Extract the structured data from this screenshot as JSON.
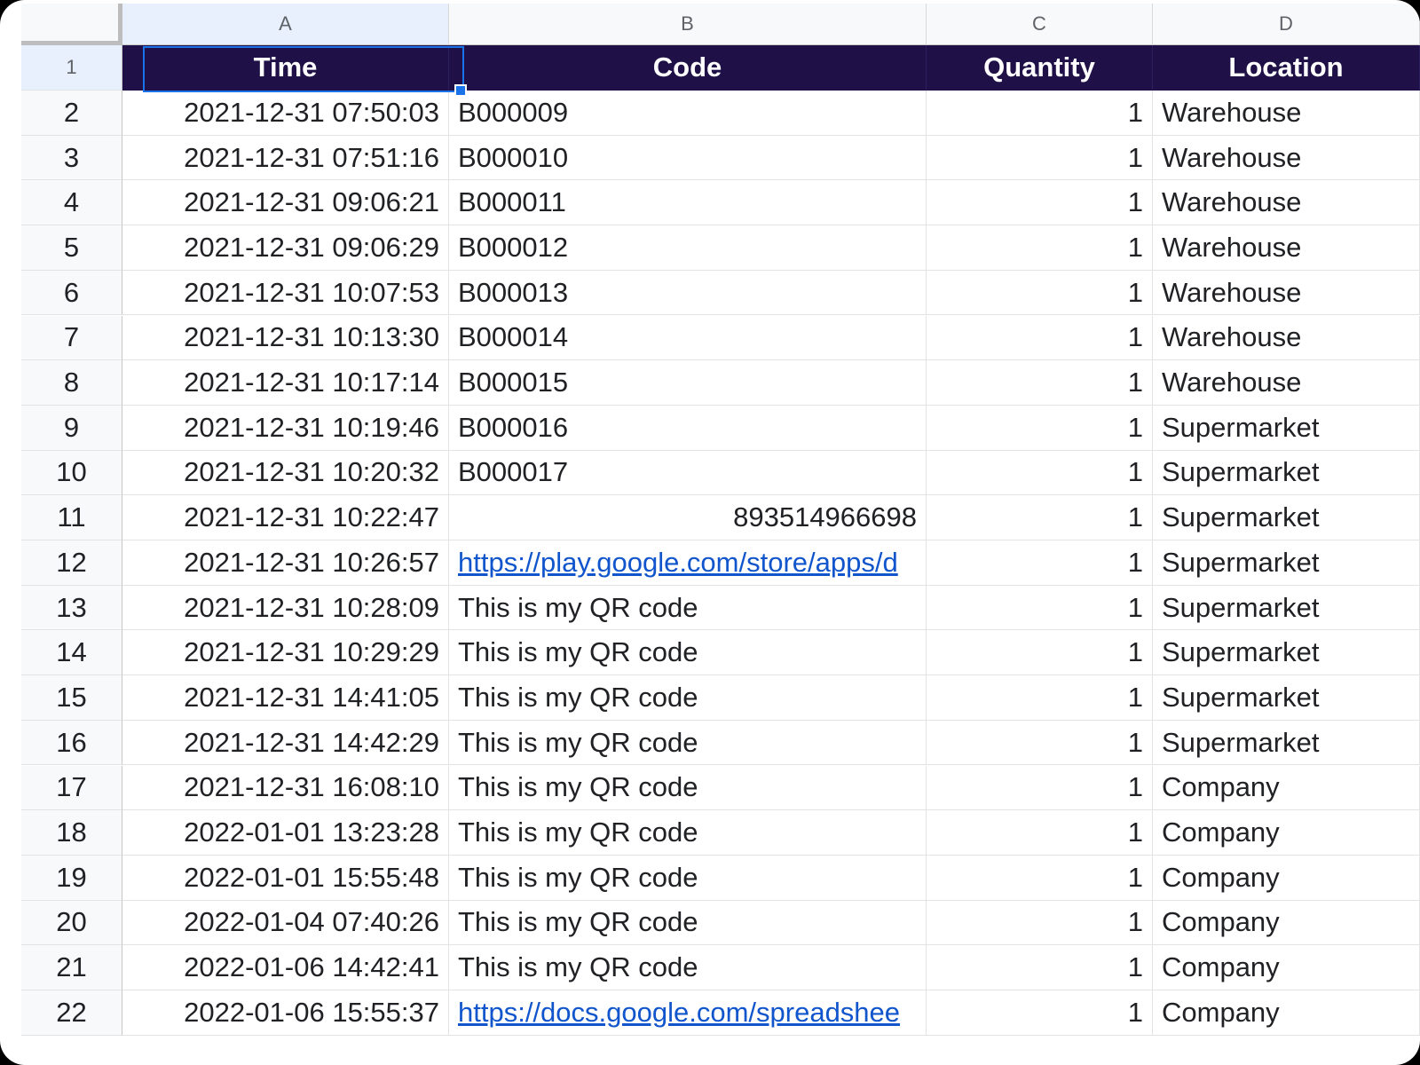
{
  "columns": [
    "A",
    "B",
    "C",
    "D"
  ],
  "headers": {
    "row_number": "1",
    "time": "Time",
    "code": "Code",
    "quantity": "Quantity",
    "location": "Location"
  },
  "rows": [
    {
      "n": "2",
      "time": "2021-12-31 07:50:03",
      "code": "B000009",
      "qty": "1",
      "loc": "Warehouse"
    },
    {
      "n": "3",
      "time": "2021-12-31 07:51:16",
      "code": "B000010",
      "qty": "1",
      "loc": "Warehouse"
    },
    {
      "n": "4",
      "time": "2021-12-31 09:06:21",
      "code": "B000011",
      "qty": "1",
      "loc": "Warehouse"
    },
    {
      "n": "5",
      "time": "2021-12-31 09:06:29",
      "code": "B000012",
      "qty": "1",
      "loc": "Warehouse"
    },
    {
      "n": "6",
      "time": "2021-12-31 10:07:53",
      "code": "B000013",
      "qty": "1",
      "loc": "Warehouse"
    },
    {
      "n": "7",
      "time": "2021-12-31 10:13:30",
      "code": "B000014",
      "qty": "1",
      "loc": "Warehouse"
    },
    {
      "n": "8",
      "time": "2021-12-31 10:17:14",
      "code": "B000015",
      "qty": "1",
      "loc": "Warehouse"
    },
    {
      "n": "9",
      "time": "2021-12-31 10:19:46",
      "code": "B000016",
      "qty": "1",
      "loc": "Supermarket"
    },
    {
      "n": "10",
      "time": "2021-12-31 10:20:32",
      "code": "B000017",
      "qty": "1",
      "loc": "Supermarket"
    },
    {
      "n": "11",
      "time": "2021-12-31 10:22:47",
      "code": "893514966698",
      "qty": "1",
      "loc": "Supermarket"
    },
    {
      "n": "12",
      "time": "2021-12-31 10:26:57",
      "code": "https://play.google.com/store/apps/d",
      "qty": "1",
      "loc": "Supermarket"
    },
    {
      "n": "13",
      "time": "2021-12-31 10:28:09",
      "code": "This is my QR code",
      "qty": "1",
      "loc": "Supermarket"
    },
    {
      "n": "14",
      "time": "2021-12-31 10:29:29",
      "code": "This is my QR code",
      "qty": "1",
      "loc": "Supermarket"
    },
    {
      "n": "15",
      "time": "2021-12-31 14:41:05",
      "code": "This is my QR code",
      "qty": "1",
      "loc": "Supermarket"
    },
    {
      "n": "16",
      "time": "2021-12-31 14:42:29",
      "code": "This is my QR code",
      "qty": "1",
      "loc": "Supermarket"
    },
    {
      "n": "17",
      "time": "2021-12-31 16:08:10",
      "code": "This is my QR code",
      "qty": "1",
      "loc": "Company"
    },
    {
      "n": "18",
      "time": "2022-01-01 13:23:28",
      "code": "This is my QR code",
      "qty": "1",
      "loc": "Company"
    },
    {
      "n": "19",
      "time": "2022-01-01 15:55:48",
      "code": "This is my QR code",
      "qty": "1",
      "loc": "Company"
    },
    {
      "n": "20",
      "time": "2022-01-04 07:40:26",
      "code": "This is my QR code",
      "qty": "1",
      "loc": "Company"
    },
    {
      "n": "21",
      "time": "2022-01-06 14:42:41",
      "code": "This is my QR code",
      "qty": "1",
      "loc": "Company"
    },
    {
      "n": "22",
      "time": "2022-01-06 15:55:37",
      "code": "https://docs.google.com/spreadshee",
      "qty": "1",
      "loc": "Company"
    }
  ],
  "colors": {
    "header_bg": "#1f1147",
    "header_text": "#ffffff",
    "selection": "#1a73e8",
    "link": "#1155cc"
  }
}
